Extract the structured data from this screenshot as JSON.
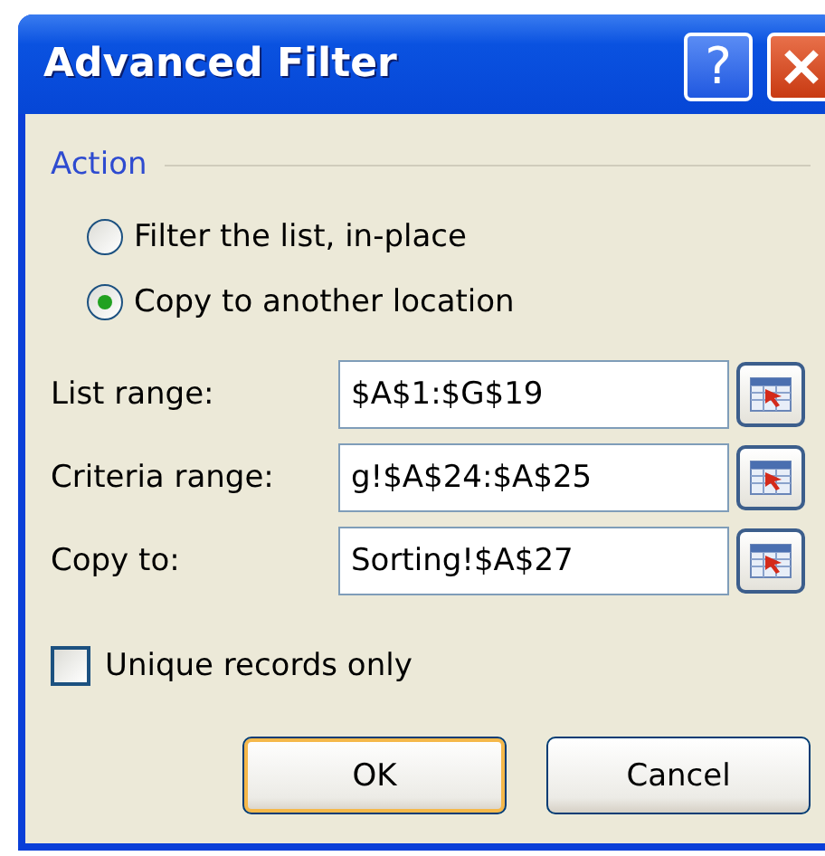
{
  "window": {
    "title": "Advanced Filter",
    "buttons": [
      {
        "kind": "help",
        "label": "?"
      },
      {
        "kind": "close"
      }
    ]
  },
  "action": {
    "title": "Action",
    "options": [
      {
        "label": "Filter the list, in-place",
        "selected": false
      },
      {
        "label": "Copy to another location",
        "selected": true
      }
    ]
  },
  "fields": [
    {
      "label": "List range:",
      "value": "$A$1:$G$19"
    },
    {
      "label": "Criteria range:",
      "value": "g!$A$24:$A$25"
    },
    {
      "label": "Copy to:",
      "value": "Sorting!$A$27"
    }
  ],
  "unique": {
    "label": "Unique records only",
    "checked": false
  },
  "buttons": [
    {
      "label": "OK",
      "default": true
    },
    {
      "label": "Cancel",
      "default": false
    }
  ]
}
